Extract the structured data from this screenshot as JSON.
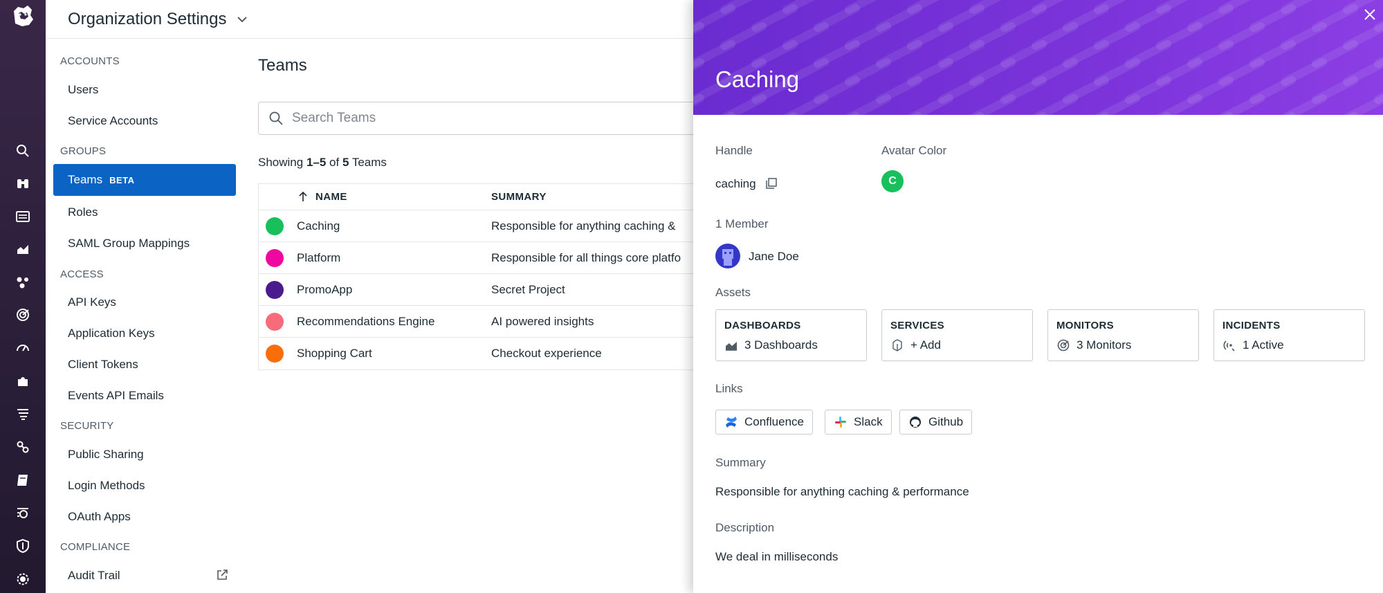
{
  "header": {
    "title": "Organization Settings"
  },
  "rail": {
    "icons": [
      "datadog-logo-icon",
      "search-icon",
      "binoculars-icon",
      "dashboard-icon",
      "chart-icon",
      "services-icon",
      "monitors-icon",
      "speed-icon",
      "integrations-icon",
      "logs-icon",
      "link-icon",
      "notebook-icon",
      "watchdog-icon",
      "security-icon",
      "settings-icon"
    ]
  },
  "nav": {
    "sections": [
      {
        "title": "ACCOUNTS",
        "items": [
          "Users",
          "Service Accounts"
        ]
      },
      {
        "title": "GROUPS",
        "items": [
          "Teams",
          "Roles",
          "SAML Group Mappings"
        ]
      },
      {
        "title": "ACCESS",
        "items": [
          "API Keys",
          "Application Keys",
          "Client Tokens",
          "Events API Emails"
        ]
      },
      {
        "title": "SECURITY",
        "items": [
          "Public Sharing",
          "Login Methods",
          "OAuth Apps"
        ]
      },
      {
        "title": "COMPLIANCE",
        "items": [
          "Audit Trail"
        ]
      }
    ],
    "active_item": "Teams",
    "beta_badge": "BETA"
  },
  "main": {
    "title": "Teams",
    "search_placeholder": "Search Teams",
    "showing": {
      "prefix": "Showing ",
      "range": "1–5",
      "middle": " of ",
      "total": "5",
      "suffix": " Teams"
    },
    "columns": {
      "name": "NAME",
      "summary": "SUMMARY"
    },
    "rows": [
      {
        "name": "Caching",
        "summary": "Responsible for anything caching &",
        "color": "#17c05b"
      },
      {
        "name": "Platform",
        "summary": "Responsible for all things core platfo",
        "color": "#f0079f"
      },
      {
        "name": "PromoApp",
        "summary": "Secret Project",
        "color": "#4a1b8c"
      },
      {
        "name": "Recommendations Engine",
        "summary": "AI powered insights",
        "color": "#f76b7b"
      },
      {
        "name": "Shopping Cart",
        "summary": "Checkout experience",
        "color": "#fa6e0a"
      }
    ]
  },
  "drawer": {
    "title": "Caching",
    "handle_label": "Handle",
    "handle_value": "caching",
    "avatar_color_label": "Avatar Color",
    "avatar_letter": "C",
    "avatar_color": "#17c05b",
    "members_label": "1 Member",
    "member_name": "Jane Doe",
    "assets_label": "Assets",
    "assets": [
      {
        "title": "DASHBOARDS",
        "value": "3 Dashboards",
        "icon": "dashboard-area-icon"
      },
      {
        "title": "SERVICES",
        "value": "+ Add",
        "icon": "services-hex-icon"
      },
      {
        "title": "MONITORS",
        "value": "3 Monitors",
        "icon": "monitor-icon"
      },
      {
        "title": "INCIDENTS",
        "value": "1 Active",
        "icon": "incident-icon"
      }
    ],
    "links_label": "Links",
    "links": [
      {
        "label": "Confluence",
        "icon": "confluence-icon"
      },
      {
        "label": "Slack",
        "icon": "slack-icon"
      },
      {
        "label": "Github",
        "icon": "github-icon"
      }
    ],
    "summary_label": "Summary",
    "summary_value": "Responsible for anything caching & performance",
    "description_label": "Description",
    "description_value": "We deal in milliseconds",
    "banner_color": "#7a33d9"
  }
}
